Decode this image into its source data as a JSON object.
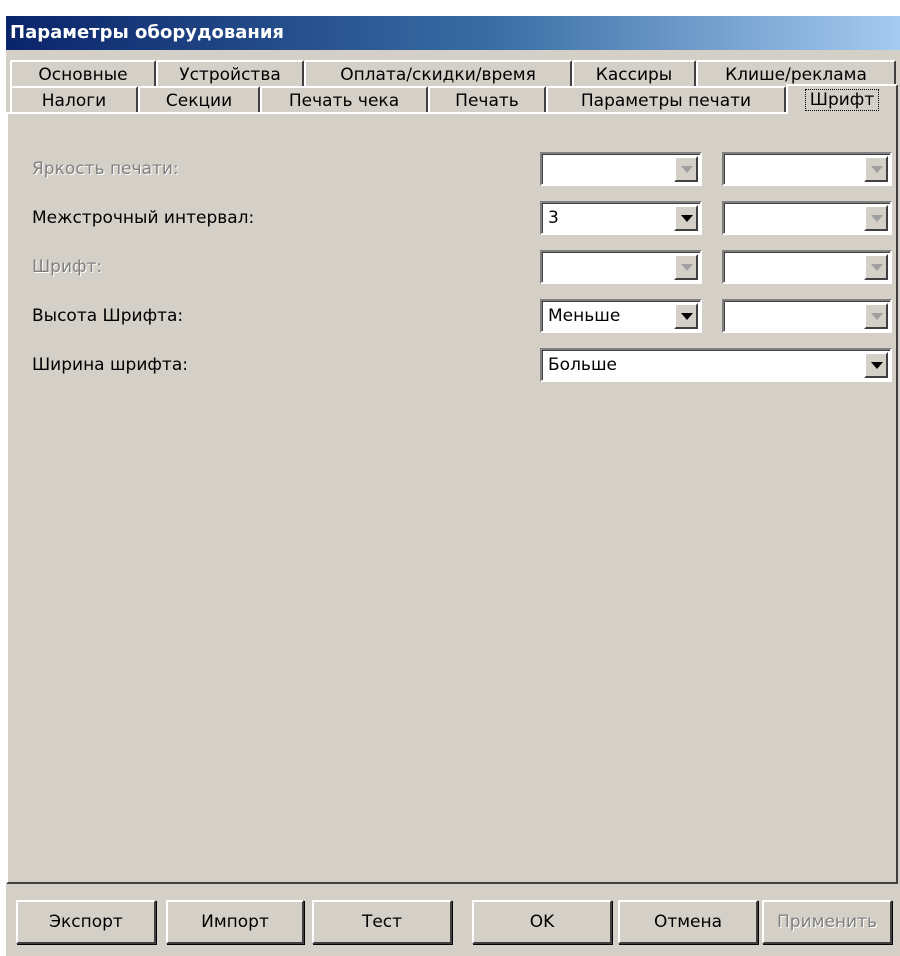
{
  "window": {
    "title": "Параметры оборудования"
  },
  "tabs_row1": [
    {
      "label": "Основные"
    },
    {
      "label": "Устройства"
    },
    {
      "label": "Оплата/скидки/время"
    },
    {
      "label": "Кассиры"
    },
    {
      "label": "Клише/реклама"
    }
  ],
  "tabs_row2": [
    {
      "label": "Налоги"
    },
    {
      "label": "Секции"
    },
    {
      "label": "Печать чека"
    },
    {
      "label": "Печать"
    },
    {
      "label": "Параметры печати"
    },
    {
      "label": "Шрифт",
      "active": true
    }
  ],
  "fields": [
    {
      "label": "Яркость печати:",
      "enabled": false,
      "value1": "",
      "value2": ""
    },
    {
      "label": "Межстрочный интервал:",
      "enabled": true,
      "value1": "3",
      "value2": ""
    },
    {
      "label": "Шрифт:",
      "enabled": false,
      "value1": "",
      "value2": ""
    },
    {
      "label": "Высота Шрифта:",
      "enabled": true,
      "value1": "Меньше",
      "value2": ""
    },
    {
      "label": "Ширина шрифта:",
      "enabled": true,
      "value1": "Больше"
    }
  ],
  "buttons": {
    "export": "Экспорт",
    "import": "Импорт",
    "test": "Тест",
    "ok": "OK",
    "cancel": "Отмена",
    "apply": "Применить"
  }
}
